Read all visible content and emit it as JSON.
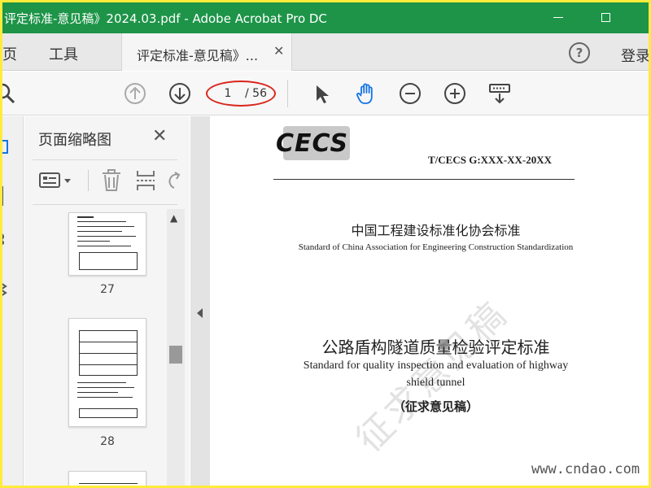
{
  "window": {
    "title": "评定标准-意见稿》2024.03.pdf - Adobe Acrobat Pro DC"
  },
  "tabs": {
    "home_label": "主页",
    "tools_label": "工具",
    "doc_tab_label": "评定标准-意见稿》...",
    "login_label": "登录"
  },
  "toolbar": {
    "current_page": "1",
    "total_pages": "/ 56"
  },
  "thumbnails": {
    "pane_title": "页面缩略图",
    "pages": [
      "27",
      "28"
    ]
  },
  "document": {
    "logo_text": "CECS",
    "code": "T/CECS G:XXX-XX-20XX",
    "org_cn": "中国工程建设标准化协会标准",
    "org_en": "Standard of China Association for Engineering Construction Standardization",
    "standard_cn": "公路盾构隧道质量检验评定标准",
    "standard_en_line1": "Standard for quality inspection and evaluation of highway",
    "standard_en_line2": "shield tunnel",
    "draft_label": "（征求意见稿）",
    "watermark": "征求意见稿",
    "site_watermark": "www.cndao.com"
  },
  "colors": {
    "titlebar": "#1d9448",
    "highlight_oval": "#d9261c",
    "hand_tool_active": "#1473e6",
    "screenshot_border": "#ffeb3b"
  }
}
